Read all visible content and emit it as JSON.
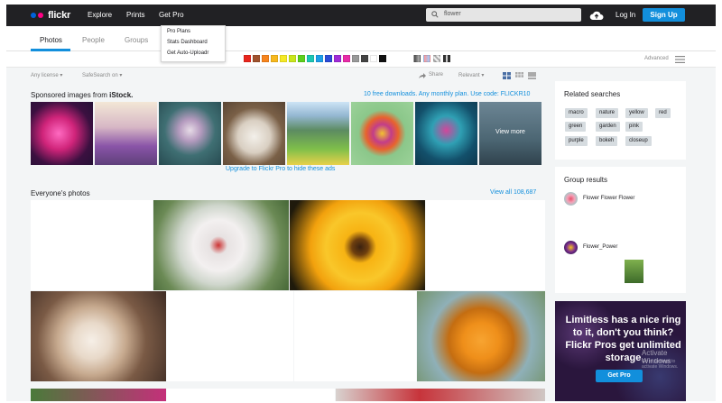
{
  "header": {
    "logo_text": "flickr",
    "nav": [
      "Explore",
      "Prints",
      "Get Pro"
    ],
    "search": {
      "value": "flower"
    },
    "login_label": "Log In",
    "signup_label": "Sign Up"
  },
  "dropdown": {
    "items": [
      "Pro Plans",
      "Stats Dashboard",
      "Get Auto-Uploadr"
    ]
  },
  "tabs": [
    "Photos",
    "People",
    "Groups"
  ],
  "filters": {
    "colors": [
      "#e8251c",
      "#a0522d",
      "#f7841c",
      "#f7b81c",
      "#f5e924",
      "#c9e61c",
      "#5dd01c",
      "#1cc6b4",
      "#1c9ee8",
      "#2b4bd6",
      "#a02bd6",
      "#e82ba8",
      "#999999",
      "#444444",
      "#ffffff",
      "#111111"
    ],
    "advanced_label": "Advanced"
  },
  "toolbar": {
    "license": "Any license",
    "safesearch": "SafeSearch on",
    "share": "Share",
    "relevant": "Relevant"
  },
  "sponsored": {
    "title": "Sponsored images from",
    "brand": "iStock.",
    "offer": "10 free downloads. Any monthly plan. Use code: FLICKR10",
    "view_more": "View more",
    "upgrade": "Upgrade to Flickr Pro to hide these ads"
  },
  "everyone": {
    "title": "Everyone's photos",
    "view_all": "View all 108,687"
  },
  "sidebar": {
    "related_title": "Related searches",
    "tags": [
      "macro",
      "nature",
      "yellow",
      "red",
      "green",
      "garden",
      "pink",
      "purple",
      "bokeh",
      "closeup"
    ],
    "groups_title": "Group results",
    "groups": [
      "Flower Flower Flower",
      "Flower_Power"
    ],
    "promo_text": "Limitless has a nice ring to it, don't you think? Flickr Pros get unlimited storage",
    "promo_button": "Get Pro",
    "watermark_1": "Activate Windows",
    "watermark_2": "Go to Settings to activate Windows."
  },
  "colors": {
    "accent": "#128fdc",
    "nav_bg": "#212124",
    "logo_blue": "#0063dc",
    "logo_pink": "#ff0084"
  }
}
